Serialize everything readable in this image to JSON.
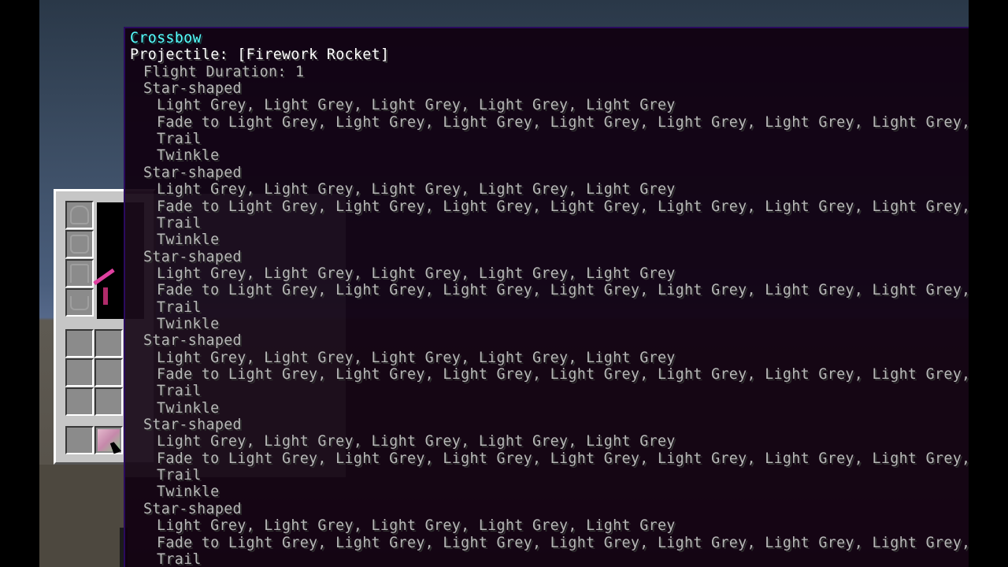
{
  "tooltip": {
    "title": "Crossbow",
    "projectile": "Projectile: [Firework Rocket]",
    "flight_duration": "Flight Duration: 1",
    "explosions": [
      {
        "shape": "Star-shaped",
        "colors": "Light Grey, Light Grey, Light Grey, Light Grey, Light Grey",
        "fade": "Fade to Light Grey, Light Grey, Light Grey, Light Grey, Light Grey, Light Grey, Light Grey, Light Gr",
        "trail": "Trail",
        "twinkle": "Twinkle"
      },
      {
        "shape": "Star-shaped",
        "colors": "Light Grey, Light Grey, Light Grey, Light Grey, Light Grey",
        "fade": "Fade to Light Grey, Light Grey, Light Grey, Light Grey, Light Grey, Light Grey, Light Grey, Light Gr",
        "trail": "Trail",
        "twinkle": "Twinkle"
      },
      {
        "shape": "Star-shaped",
        "colors": "Light Grey, Light Grey, Light Grey, Light Grey, Light Grey",
        "fade": "Fade to Light Grey, Light Grey, Light Grey, Light Grey, Light Grey, Light Grey, Light Grey, Light Gr",
        "trail": "Trail",
        "twinkle": "Twinkle"
      },
      {
        "shape": "Star-shaped",
        "colors": "Light Grey, Light Grey, Light Grey, Light Grey, Light Grey",
        "fade": "Fade to Light Grey, Light Grey, Light Grey, Light Grey, Light Grey, Light Grey, Light Grey, Light Gr",
        "trail": "Trail",
        "twinkle": "Twinkle"
      },
      {
        "shape": "Star-shaped",
        "colors": "Light Grey, Light Grey, Light Grey, Light Grey, Light Grey",
        "fade": "Fade to Light Grey, Light Grey, Light Grey, Light Grey, Light Grey, Light Grey, Light Grey, Light Gr",
        "trail": "Trail",
        "twinkle": "Twinkle"
      },
      {
        "shape": "Star-shaped",
        "colors": "Light Grey, Light Grey, Light Grey, Light Grey, Light Grey",
        "fade": "Fade to Light Grey, Light Grey, Light Grey, Light Grey, Light Grey, Light Grey, Light Grey, Light Gr",
        "trail": "Trail"
      }
    ]
  },
  "inventory": {
    "armor_slot_icons": [
      "helmet-icon",
      "chestplate-icon",
      "leggings-icon",
      "boots-icon"
    ],
    "offhand_item_icon": "crossbow-icon"
  },
  "colors": {
    "title": "#55ffff",
    "projectile": "#ffffff",
    "body_text": "#b8b8b8",
    "tooltip_bg": "#100010",
    "tooltip_border": "#2a0a5e",
    "panel": "#c6c6c6",
    "slot": "#8b8b8b"
  }
}
